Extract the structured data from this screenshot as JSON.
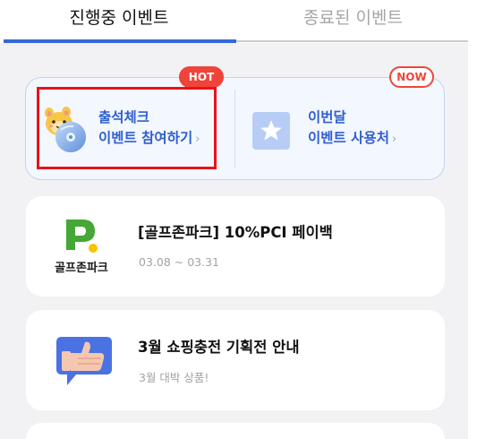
{
  "tabs": [
    {
      "label": "진행중 이벤트",
      "active": true
    },
    {
      "label": "종료된 이벤트",
      "active": false
    }
  ],
  "quick": {
    "attendance": {
      "line1": "출석체크",
      "line2": "이벤트 참여하기",
      "chevron": "›",
      "badge": "HOT",
      "icon": "character-disc-icon"
    },
    "monthly": {
      "line1": "이번달",
      "line2": "이벤트 사용처",
      "chevron": "›",
      "badge": "NOW",
      "icon": "star-icon"
    }
  },
  "events": [
    {
      "title": "[골프존파크] 10%PCI 페이백",
      "subtitle": "03.08 ~ 03.31",
      "logo_text": "골프존파크",
      "icon": "golfzon-park-logo"
    },
    {
      "title": "3월 쇼핑충전 기획전 안내",
      "subtitle": "3월 대박 상품!",
      "icon": "thumbs-up-icon"
    }
  ],
  "colors": {
    "accent": "#3468d9",
    "badge": "#f0443a",
    "highlight": "#e8141b",
    "label_blue": "#2f5fd0"
  }
}
